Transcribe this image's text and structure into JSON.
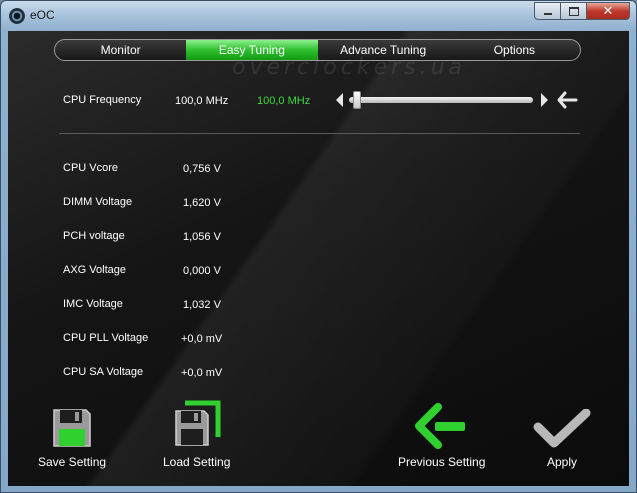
{
  "window": {
    "title": "eOC"
  },
  "tabs": [
    {
      "label": "Monitor"
    },
    {
      "label": "Easy Tuning"
    },
    {
      "label": "Advance Tuning"
    },
    {
      "label": "Options"
    }
  ],
  "watermark": "overclockers.ua",
  "cpu_frequency": {
    "label": "CPU Frequency",
    "current": "100,0 MHz",
    "target": "100,0 MHz"
  },
  "voltages": [
    {
      "label": "CPU Vcore",
      "value": "0,756 V"
    },
    {
      "label": "DIMM Voltage",
      "value": "1,620 V"
    },
    {
      "label": "PCH voltage",
      "value": "1,056 V"
    },
    {
      "label": "AXG Voltage",
      "value": "0,000 V"
    },
    {
      "label": "IMC Voltage",
      "value": "1,032 V"
    },
    {
      "label": "CPU PLL Voltage",
      "value": "+0,0 mV"
    },
    {
      "label": "CPU SA Voltage",
      "value": "+0,0 mV"
    }
  ],
  "actions": {
    "save": "Save Setting",
    "load": "Load Setting",
    "previous": "Previous Setting",
    "apply": "Apply"
  },
  "colors": {
    "accent": "#2fc02f",
    "highlight_text": "#3ddc3d",
    "background": "#111111"
  },
  "icons": {
    "save": "floppy-disk-icon",
    "load": "floppy-load-icon",
    "previous": "back-arrow-icon",
    "apply": "checkmark-icon",
    "reset": "reset-arrow-icon"
  }
}
